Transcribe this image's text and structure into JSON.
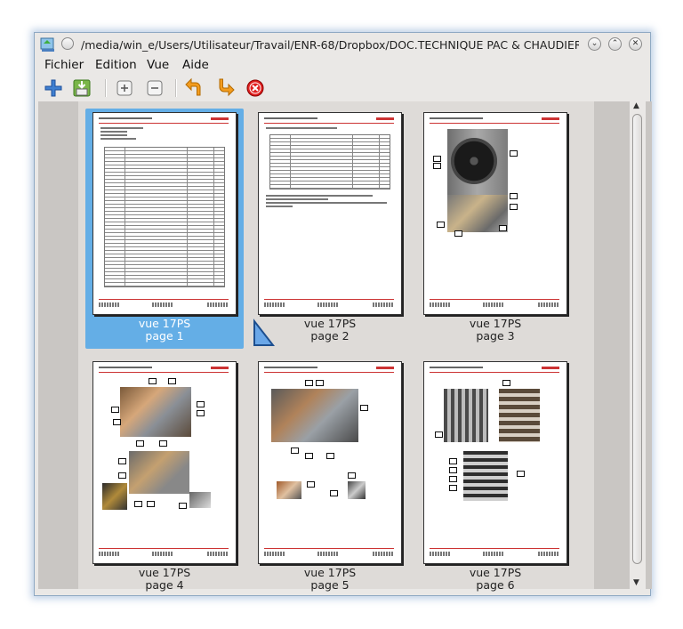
{
  "window": {
    "title": "/media/win_e/Users/Utilisateur/Travail/ENR-68/Dropbox/DOC.TECHNIQUE PAC & CHAUDIERES/Dim...",
    "app_icon": "pdf-shuffler-icon"
  },
  "menubar": {
    "items": [
      "Fichier",
      "Edition",
      "Vue",
      "Aide"
    ]
  },
  "toolbar": {
    "tools": [
      "add-file-icon",
      "export-icon",
      "zoom-in-icon",
      "zoom-out-icon",
      "rotate-left-icon",
      "rotate-right-icon",
      "delete-icon"
    ]
  },
  "pages": [
    {
      "name": "vue 17PS",
      "page": "page 1",
      "selected": true
    },
    {
      "name": "vue 17PS",
      "page": "page 2",
      "selected": false
    },
    {
      "name": "vue 17PS",
      "page": "page 3",
      "selected": false
    },
    {
      "name": "vue 17PS",
      "page": "page 4",
      "selected": false
    },
    {
      "name": "vue 17PS",
      "page": "page 5",
      "selected": false
    },
    {
      "name": "vue 17PS",
      "page": "page 6",
      "selected": false
    }
  ],
  "colors": {
    "selection": "#64aee6",
    "accent_red": "#cc3333"
  }
}
